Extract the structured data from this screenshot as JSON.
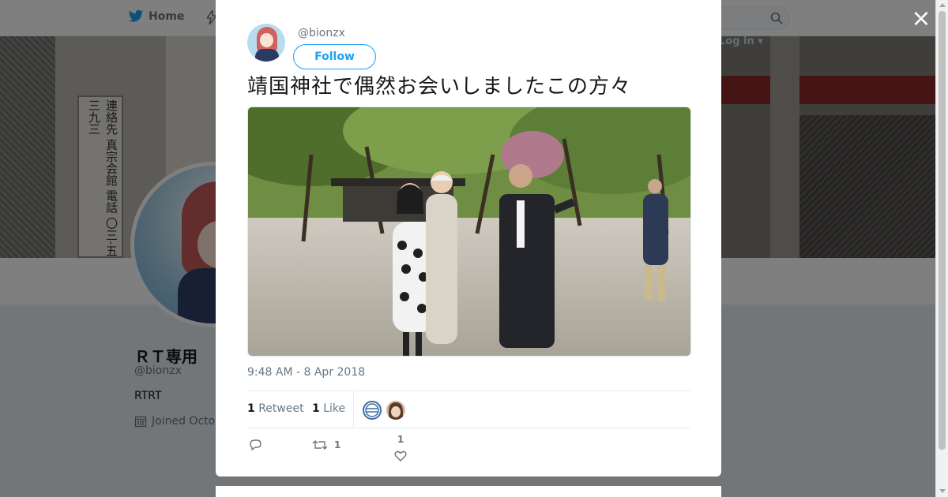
{
  "topnav": {
    "home_label": "Home",
    "login_label": "Log in"
  },
  "banner": {
    "sign_text": "連絡先 真宗会館 電話 〇三-五三九三"
  },
  "profile": {
    "name": "ＲＴ専用",
    "handle": "@bionzx",
    "bio": "RTRT",
    "joined": "Joined Octo"
  },
  "tweet": {
    "handle": "@bionzx",
    "follow_label": "Follow",
    "text": "靖国神社で偶然お会いしましたこの方々",
    "timestamp": "9:48 AM - 8 Apr 2018",
    "retweets_count": "1",
    "retweets_label": "Retweet",
    "likes_count": "1",
    "likes_label": "Like",
    "actions": {
      "reply_count": "",
      "retweet_count": "1",
      "like_count": "1"
    }
  },
  "close_label": "×",
  "colors": {
    "accent": "#1da1f2",
    "text_secondary": "#657786",
    "text_primary": "#14171a"
  },
  "icons": [
    "twitter-bird-icon",
    "lightning-icon",
    "search-icon",
    "calendar-icon",
    "close-icon",
    "reply-icon",
    "retweet-icon",
    "heart-icon"
  ]
}
